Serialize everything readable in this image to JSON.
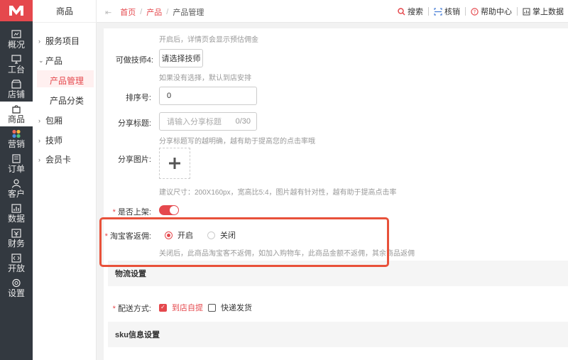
{
  "rail": {
    "items": [
      {
        "label": "概况",
        "icon": "overview-icon"
      },
      {
        "label": "工台",
        "icon": "monitor-icon"
      },
      {
        "label": "店铺",
        "icon": "store-icon"
      },
      {
        "label": "商品",
        "icon": "bag-icon",
        "active": true
      },
      {
        "label": "营销",
        "icon": "marketing-icon"
      },
      {
        "label": "订单",
        "icon": "order-icon"
      },
      {
        "label": "客户",
        "icon": "customer-icon"
      },
      {
        "label": "数据",
        "icon": "data-icon"
      },
      {
        "label": "财务",
        "icon": "finance-icon"
      },
      {
        "label": "开放",
        "icon": "open-icon"
      },
      {
        "label": "设置",
        "icon": "settings-icon"
      }
    ]
  },
  "subnav": {
    "title": "商品",
    "items": [
      {
        "label": "服务项目"
      },
      {
        "label": "产品"
      },
      {
        "label": "产品管理"
      },
      {
        "label": "产品分类"
      },
      {
        "label": "包厢"
      },
      {
        "label": "技师"
      },
      {
        "label": "会员卡"
      }
    ]
  },
  "topbar": {
    "breadcrumbs": [
      "首页",
      "产品",
      "产品管理"
    ],
    "actions": [
      "搜索",
      "核销",
      "帮助中心",
      "掌上数据"
    ]
  },
  "form": {
    "top_hint": "开启后，详情页会显示预估佣金",
    "tech4": {
      "label": "可做技师4:",
      "button": "请选择技师",
      "hint": "如果没有选择，默认到店安排"
    },
    "sort": {
      "label": "排序号:",
      "value": "0"
    },
    "share_title": {
      "label": "分享标题:",
      "placeholder": "请输入分享标题",
      "count": "0/30",
      "hint": "分享标题写的越明确，越有助于提高您的点击率哦"
    },
    "share_image": {
      "label": "分享图片:",
      "hint": "建议尺寸：200X160px，宽高比5:4，图片越有针对性，越有助于提高点击率"
    },
    "on_shelf": {
      "label": "是否上架:",
      "value": true
    },
    "rebate": {
      "label": "淘宝客返佣:",
      "options": [
        "开启",
        "关闭"
      ],
      "selected": "开启",
      "hint": "关闭后，此商品淘宝客不返佣，如加入购物车，此商品金额不返佣，其余商品返佣"
    },
    "logistics": {
      "section": "物流设置",
      "label": "配送方式:",
      "options": [
        "到店自提",
        "快递发货"
      ],
      "checked": [
        "到店自提"
      ]
    },
    "sku_section": "sku信息设置"
  },
  "colors": {
    "accent": "#e5484d",
    "highlight_border": "#e8513a",
    "rail_bg": "#333940"
  }
}
